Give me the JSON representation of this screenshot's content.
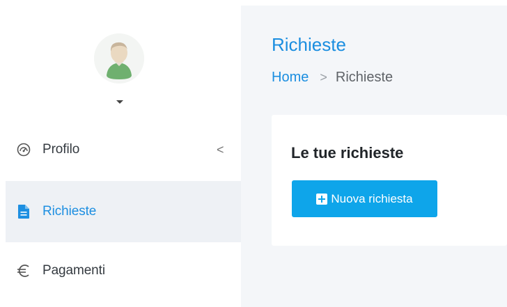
{
  "sidebar": {
    "avatar_alt": "avatar",
    "items": [
      {
        "label": "Profilo",
        "icon": "dashboard-gauge-icon",
        "has_chevron": true,
        "active": false
      },
      {
        "label": "Richieste",
        "icon": "file-document-icon",
        "has_chevron": false,
        "active": true
      },
      {
        "label": "Pagamenti",
        "icon": "euro-icon",
        "has_chevron": false,
        "active": false
      }
    ],
    "chevron_glyph": "<"
  },
  "header": {
    "title": "Richieste",
    "breadcrumb": {
      "home": "Home",
      "separator": ">",
      "current": "Richieste"
    }
  },
  "card": {
    "title": "Le tue richieste",
    "new_button_label": "Nuova richiesta"
  },
  "colors": {
    "accent": "#1b8ee0",
    "button": "#0ea5ea",
    "active_bg": "#eef1f5",
    "main_bg": "#f4f6f9"
  }
}
